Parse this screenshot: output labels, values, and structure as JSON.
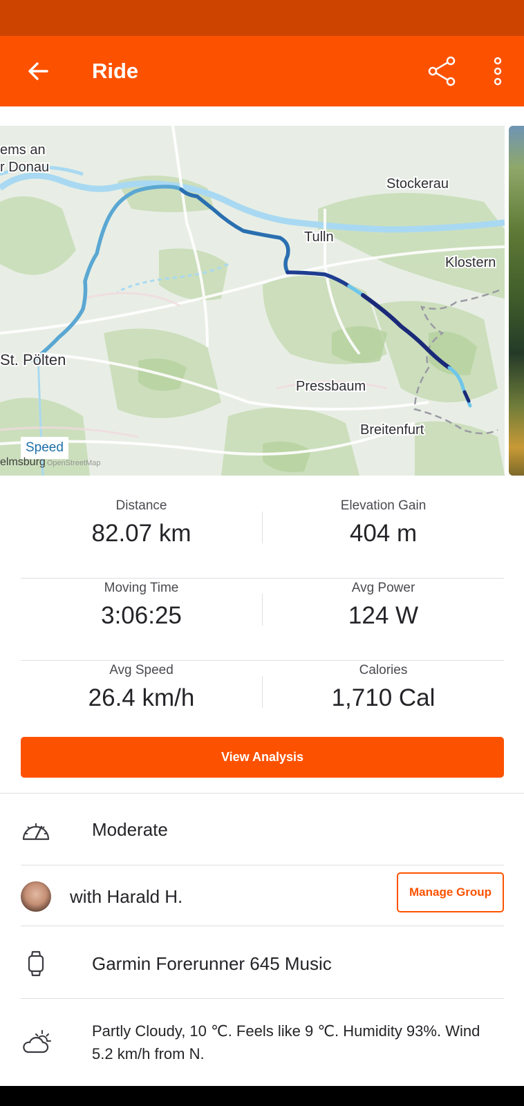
{
  "app_bar": {
    "title": "Ride",
    "back_icon": "arrow-left-icon",
    "share_icon": "share-icon",
    "more_icon": "more-vertical-icon"
  },
  "map": {
    "places": [
      "ems an",
      "r Donau",
      "Stockerau",
      "Tulln",
      "Klostern",
      "St. Pölten",
      "Pressbaum",
      "Breitenfurt",
      "elmsburg"
    ],
    "legend_chip": "Speed",
    "attribution": "OpenStreetMap"
  },
  "stats": [
    {
      "label": "Distance",
      "value": "82.07 km"
    },
    {
      "label": "Elevation Gain",
      "value": "404 m"
    },
    {
      "label": "Moving Time",
      "value": "3:06:25"
    },
    {
      "label": "Avg Power",
      "value": "124 W"
    },
    {
      "label": "Avg Speed",
      "value": "26.4 km/h"
    },
    {
      "label": "Calories",
      "value": "1,710 Cal"
    }
  ],
  "analysis_button": "View Analysis",
  "details": {
    "effort": {
      "text": "Moderate",
      "icon": "gauge-icon"
    },
    "group": {
      "text": "with Harald H.",
      "button": "Manage Group"
    },
    "device": {
      "text": "Garmin Forerunner 645 Music",
      "icon": "watch-icon"
    },
    "weather": {
      "text": "Partly Cloudy, 10 ℃. Feels like 9 ℃. Humidity 93%. Wind 5.2 km/h from N.",
      "icon": "partly-cloudy-icon"
    }
  },
  "colors": {
    "brand": "#fc5200",
    "status_bar": "#cc4400",
    "route_dark": "#1a2a78",
    "route_mid": "#2a6fb0",
    "route_light": "#6ec6ea"
  }
}
